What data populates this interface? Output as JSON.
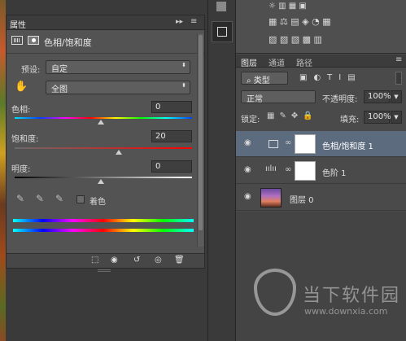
{
  "properties_panel": {
    "tab": "属性",
    "title": "色相/饱和度",
    "preset_label": "预设:",
    "preset_value": "自定",
    "channel_value": "全图",
    "hue": {
      "label": "色相:",
      "value": "0",
      "position": 0.5
    },
    "saturation": {
      "label": "饱和度:",
      "value": "20",
      "position": 0.6
    },
    "lightness": {
      "label": "明度:",
      "value": "0",
      "position": 0.5
    },
    "colorize_label": "着色",
    "accent": "#ff0000"
  },
  "layers_panel": {
    "tabs": [
      "图层",
      "通道",
      "路径"
    ],
    "filter_label": "类型",
    "blend_mode": "正常",
    "opacity_label": "不透明度:",
    "opacity_value": "100%",
    "lock_label": "锁定:",
    "fill_label": "填充:",
    "fill_value": "100%",
    "layers": [
      {
        "name": "色相/饱和度 1",
        "selected": true
      },
      {
        "name": "色阶 1",
        "selected": false
      },
      {
        "name": "图层 0",
        "selected": false
      }
    ]
  },
  "watermark": {
    "name": "当下软件园",
    "url": "www.downxia.com"
  }
}
